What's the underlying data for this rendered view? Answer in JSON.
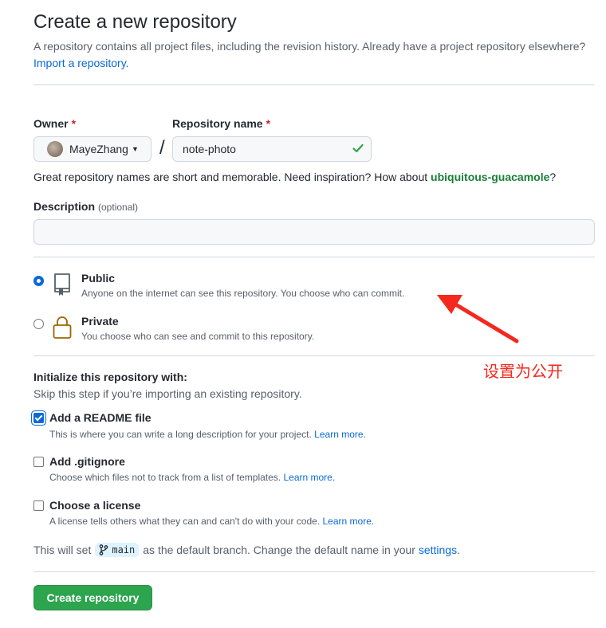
{
  "header": {
    "title": "Create a new repository",
    "subtitle_text": "A repository contains all project files, including the revision history. Already have a project repository elsewhere?",
    "import_link": "Import a repository."
  },
  "owner": {
    "label": "Owner",
    "required_mark": "*",
    "value": "MayeZhang"
  },
  "repo": {
    "label": "Repository name",
    "required_mark": "*",
    "value": "note-photo",
    "separator": "/"
  },
  "hint": {
    "text": "Great repository names are short and memorable. Need inspiration? How about",
    "suggestion": "ubiquitous-guacamole",
    "end": "?"
  },
  "description": {
    "label": "Description",
    "optional": "(optional)",
    "value": ""
  },
  "visibility": {
    "public": {
      "title": "Public",
      "desc": "Anyone on the internet can see this repository. You choose who can commit.",
      "selected": true
    },
    "private": {
      "title": "Private",
      "desc": "You choose who can see and commit to this repository.",
      "selected": false
    }
  },
  "init": {
    "title": "Initialize this repository with:",
    "subtitle": "Skip this step if you’re importing an existing repository.",
    "readme": {
      "title": "Add a README file",
      "desc": "This is where you can write a long description for your project.",
      "link": "Learn more.",
      "checked": true
    },
    "gitignore": {
      "title": "Add .gitignore",
      "desc": "Choose which files not to track from a list of templates.",
      "link": "Learn more.",
      "checked": false
    },
    "license": {
      "title": "Choose a license",
      "desc": "A license tells others what they can and can't do with your code.",
      "link": "Learn more.",
      "checked": false
    }
  },
  "branch": {
    "prefix": "This will set",
    "name": "main",
    "suffix": "as the default branch. Change the default name in your",
    "settings_link": "settings",
    "end": "."
  },
  "submit": {
    "label": "Create repository"
  },
  "annotation": {
    "text": "设置为公开"
  },
  "colors": {
    "accent": "#0969da",
    "success": "#1a7f37",
    "button": "#2da44e",
    "annotation": "#f5281e"
  }
}
